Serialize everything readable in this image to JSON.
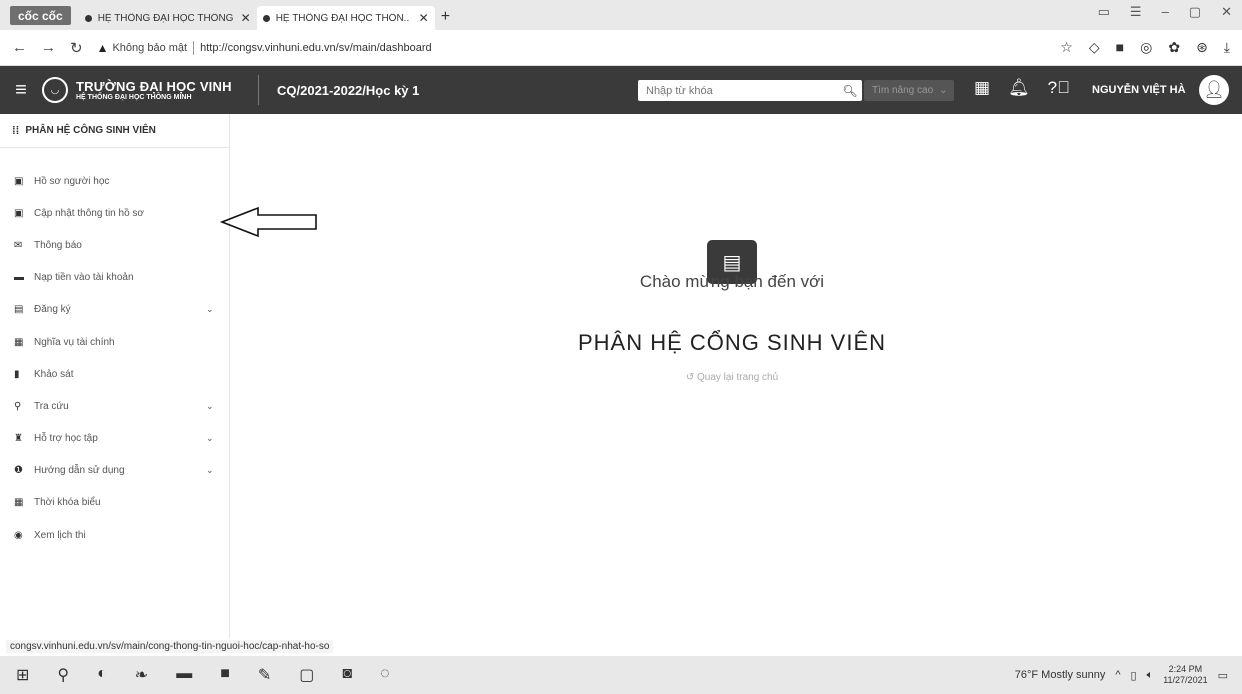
{
  "browser": {
    "brand": "cốc cốc",
    "tabs": [
      {
        "label": "HỆ THỐNG ĐẠI HỌC THÔNG",
        "active": false
      },
      {
        "label": "HỆ THỐNG ĐẠI HỌC THÔN..",
        "active": true
      }
    ],
    "new_tab": "+",
    "address": {
      "security": "Không bảo mật",
      "url": "http://congsv.vinhuni.edu.vn/sv/main/dashboard"
    }
  },
  "header": {
    "university": "TRƯỜNG ĐẠI HỌC VINH",
    "subtitle": "HỆ THỐNG ĐẠI HỌC THÔNG MINH",
    "semester": "CQ/2021-2022/Học kỳ 1",
    "search_placeholder": "Nhập từ khóa",
    "advanced_search": "Tìm nâng cao",
    "username": "NGUYỄN VIỆT HÀ"
  },
  "sidebar": {
    "title": "PHÂN HỆ CÔNG SINH VIÊN",
    "items": [
      {
        "label": "Hồ sơ người học",
        "icon": "id-card-icon",
        "glyph": "▣",
        "expandable": false
      },
      {
        "label": "Cập nhật thông tin hồ sơ",
        "icon": "id-card-icon",
        "glyph": "▣",
        "expandable": false
      },
      {
        "label": "Thông báo",
        "icon": "envelope-icon",
        "glyph": "✉",
        "expandable": false
      },
      {
        "label": "Nạp tiền vào tài khoản",
        "icon": "wallet-icon",
        "glyph": "▬",
        "expandable": false
      },
      {
        "label": "Đăng ký",
        "icon": "clipboard-icon",
        "glyph": "▤",
        "expandable": true
      },
      {
        "label": "Nghĩa vụ tài chính",
        "icon": "money-icon",
        "glyph": "▦",
        "expandable": false
      },
      {
        "label": "Khảo sát",
        "icon": "book-icon",
        "glyph": "▮",
        "expandable": false
      },
      {
        "label": "Tra cứu",
        "icon": "search-icon",
        "glyph": "⚲",
        "expandable": true
      },
      {
        "label": "Hỗ trợ học tập",
        "icon": "graduation-icon",
        "glyph": "♜",
        "expandable": true
      },
      {
        "label": "Hướng dẫn sử dụng",
        "icon": "info-icon",
        "glyph": "❶",
        "expandable": true
      },
      {
        "label": "Thời khóa biểu",
        "icon": "calendar-icon",
        "glyph": "▦",
        "expandable": false
      },
      {
        "label": "Xem lịch thi",
        "icon": "globe-icon",
        "glyph": "◉",
        "expandable": false
      }
    ]
  },
  "main": {
    "welcome": "Chào mừng bạn đến với",
    "title": "PHÂN HỆ CỔNG SINH VIÊN",
    "home_link": "Quay lại trang chủ"
  },
  "status_url": "congsv.vinhuni.edu.vn/sv/main/cong-thong-tin-nguoi-hoc/cap-nhat-ho-so",
  "taskbar": {
    "weather": "76°F  Mostly sunny",
    "time": "2:24 PM",
    "date": "11/27/2021"
  },
  "colors": {
    "header_bg": "#3a3a3a",
    "sidebar_border": "#e5e5e5"
  }
}
